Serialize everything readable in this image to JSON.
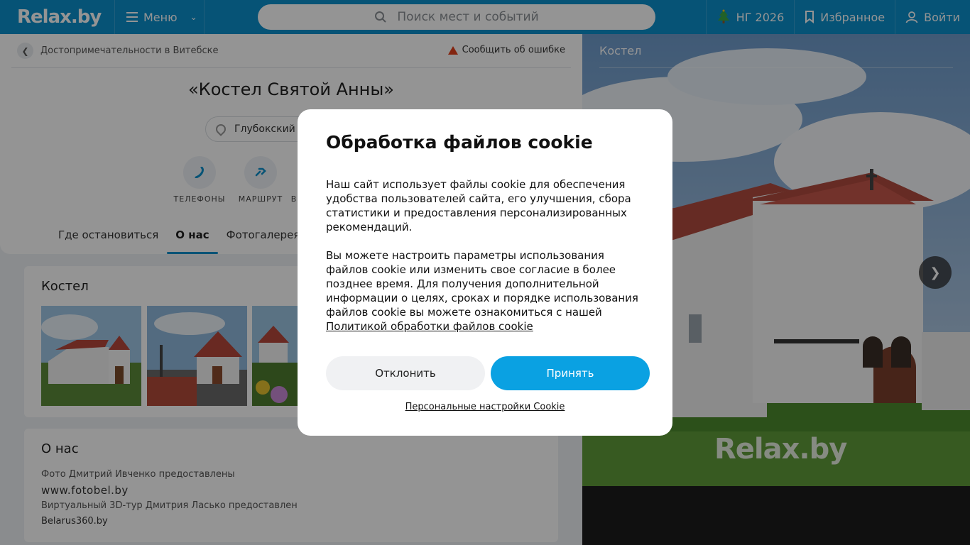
{
  "header": {
    "logo": "Relax.by",
    "menu_label": "Меню",
    "search_placeholder": "Поиск мест и событий",
    "ny_label": "НГ 2026",
    "favorites_label": "Избранное",
    "login_label": "Войти"
  },
  "breadcrumb": {
    "label": "Достопримечательности в Витебске"
  },
  "report_label": "Сообщить об ошибке",
  "place": {
    "title": "«Костел Святой Анны»",
    "address": "Глубокский"
  },
  "actions": [
    {
      "label": "ТЕЛЕФОНЫ",
      "icon": "phone-icon"
    },
    {
      "label": "МАРШРУТ",
      "icon": "route-icon"
    },
    {
      "label": "В",
      "icon": "more-icon"
    }
  ],
  "tabs": [
    {
      "label": "Где остановиться",
      "active": false
    },
    {
      "label": "О нас",
      "active": true
    },
    {
      "label": "Фотогалерея",
      "active": false
    }
  ],
  "gallery": {
    "title": "Костел"
  },
  "about": {
    "title": "О нас",
    "photo_credit": "Фото Дмитрий Ивченко предоставлены",
    "photo_site": "www.fotobel.by",
    "tour_credit": "Виртуальный 3D-тур Дмитрия Ласько предоставлен",
    "tour_site": "Belarus360.by"
  },
  "photo_panel": {
    "title": "Костел",
    "watermark": "Relax.by"
  },
  "cookie_modal": {
    "title": "Обработка файлов cookie",
    "para1": "Наш сайт использует файлы cookie для обеспечения удобства пользователей сайта, его улучшения, сбора статистики и предоставления персонализированных рекомендаций.",
    "para2": "Вы можете настроить параметры использования файлов cookie или изменить свое согласие в более позднее время. Для получения дополнительной информации о целях, сроках и порядке использования файлов cookie вы можете ознакомиться с нашей",
    "policy_link": "Политикой обработки файлов cookie",
    "decline_label": "Отклонить",
    "accept_label": "Принять",
    "personal_settings_label": "Персональные настройки Cookie"
  },
  "colors": {
    "brand": "#0b8fcb",
    "accept": "#0aa1e2",
    "warning": "#e2401c"
  }
}
